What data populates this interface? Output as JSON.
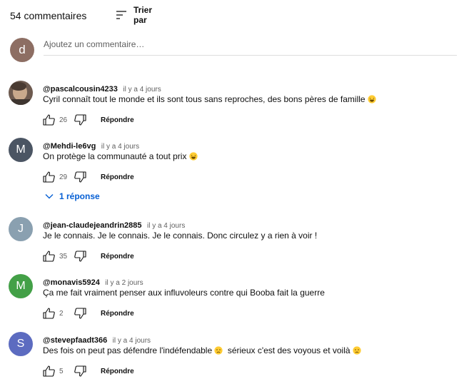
{
  "header": {
    "comment_count": "54 commentaires",
    "sort_label": "Trier par"
  },
  "add_comment": {
    "avatar_letter": "d",
    "placeholder": "Ajoutez un commentaire…"
  },
  "colors": {
    "link_blue": "#065fd4",
    "avatar_user": "#8d6e63",
    "avatar_mehdi": "#4b5563",
    "avatar_jean": "#8aa0b0",
    "avatar_monavis": "#43a047",
    "avatar_steve": "#5c6bc0"
  },
  "comments": [
    {
      "author": "@pascalcousin4233",
      "time": "il y a 4 jours",
      "text": "Cyril connaît tout le monde et ils sont tous sans reproches, des bons pères de famille",
      "emoji": "laughing",
      "likes": "26",
      "reply_label": "Répondre"
    },
    {
      "author": "@Mehdi-le6vg",
      "avatar_letter": "M",
      "time": "il y a 4 jours",
      "text": "On protège la communauté a tout prix",
      "emoji": "laughing",
      "likes": "29",
      "reply_label": "Répondre",
      "replies_label": "1 réponse"
    },
    {
      "author": "@jean-claudejeandrin2885",
      "avatar_letter": "J",
      "time": "il y a 4 jours",
      "text": "Je le connais. Je le connais. Je le connais. Donc circulez y a rien à voir !",
      "likes": "35",
      "reply_label": "Répondre"
    },
    {
      "author": "@monavis5924",
      "avatar_letter": "M",
      "time": "il y a 2 jours",
      "text": "Ça me fait vraiment penser aux influvoleurs contre qui Booba fait la guerre",
      "likes": "2",
      "reply_label": "Répondre"
    },
    {
      "author": "@stevepfaadt366",
      "avatar_letter": "S",
      "time": "il y a 4 jours",
      "text_part1": "Des fois on peut pas défendre l'indéfendable",
      "text_part2": "sérieux c'est des voyous et voilà",
      "emoji": "worried",
      "likes": "5",
      "reply_label": "Répondre"
    }
  ]
}
